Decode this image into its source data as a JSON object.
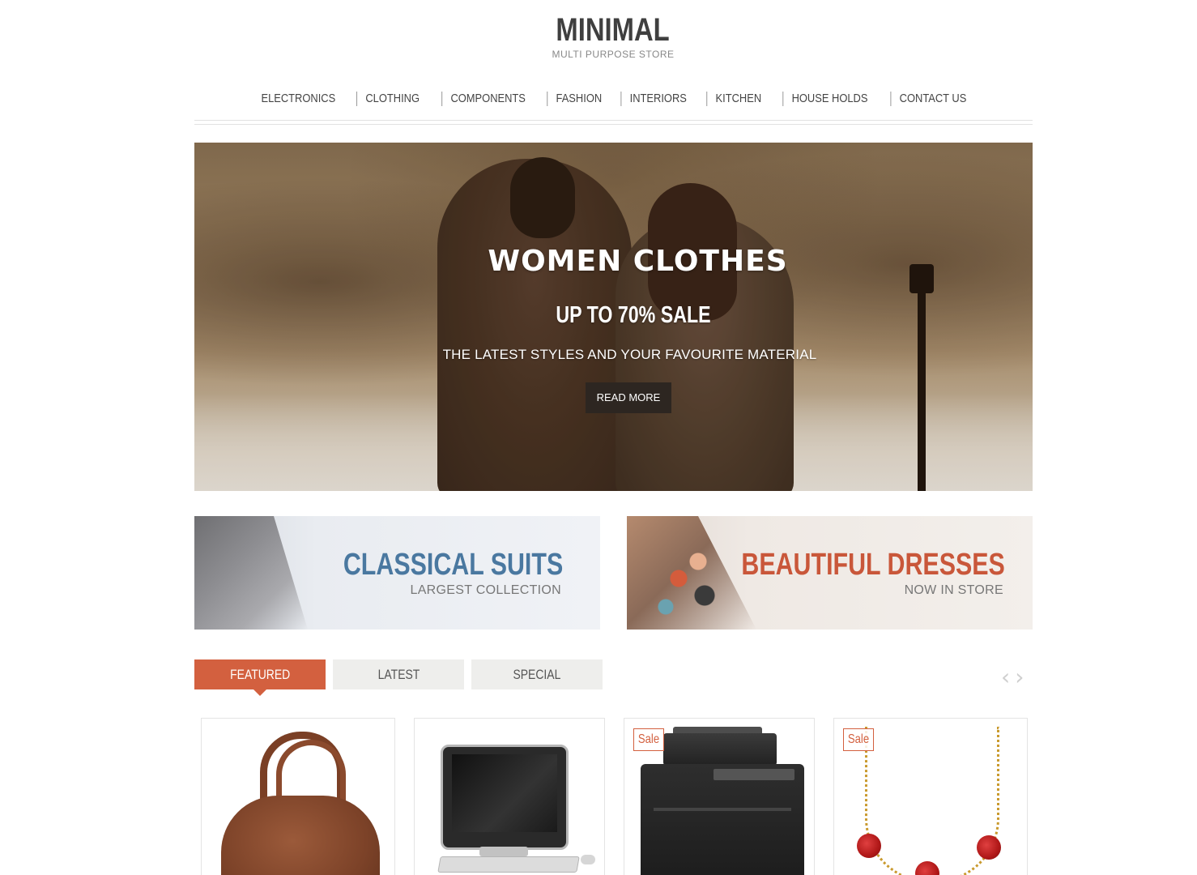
{
  "header": {
    "logo_title": "MINIMAL",
    "logo_subtitle": "MULTI PURPOSE STORE"
  },
  "nav": {
    "items": [
      {
        "label": "ELECTRONICS"
      },
      {
        "label": "CLOTHING"
      },
      {
        "label": "COMPONENTS"
      },
      {
        "label": "FASHION"
      },
      {
        "label": "INTERIORS"
      },
      {
        "label": "KITCHEN"
      },
      {
        "label": "HOUSE HOLDS"
      },
      {
        "label": "CONTACT US"
      }
    ]
  },
  "hero": {
    "title": "WOMEN CLOTHES",
    "sale": "UP TO 70% SALE",
    "description": "THE LATEST STYLES AND YOUR FAVOURITE MATERIAL",
    "button_label": "READ MORE"
  },
  "banners": [
    {
      "title": "CLASSICAL SUITS",
      "subtitle": "LARGEST COLLECTION",
      "color": "#4a78a0"
    },
    {
      "title": "BEAUTIFUL DRESSES",
      "subtitle": "NOW IN STORE",
      "color": "#c9573a"
    }
  ],
  "tabs": [
    {
      "label": "FEATURED",
      "active": true
    },
    {
      "label": "LATEST",
      "active": false
    },
    {
      "label": "SPECIAL",
      "active": false
    }
  ],
  "carousel": {
    "prev_icon": "chevron-left-icon",
    "next_icon": "chevron-right-icon"
  },
  "products": [
    {
      "image": "handbag",
      "badge": ""
    },
    {
      "image": "desktop-computer",
      "badge": ""
    },
    {
      "image": "laser-printer",
      "badge": "Sale"
    },
    {
      "image": "necklace-earrings-set",
      "badge": "Sale"
    }
  ],
  "colors": {
    "accent": "#d3603f",
    "tab_inactive": "#eeeeec",
    "button_dark": "#2d2621"
  }
}
